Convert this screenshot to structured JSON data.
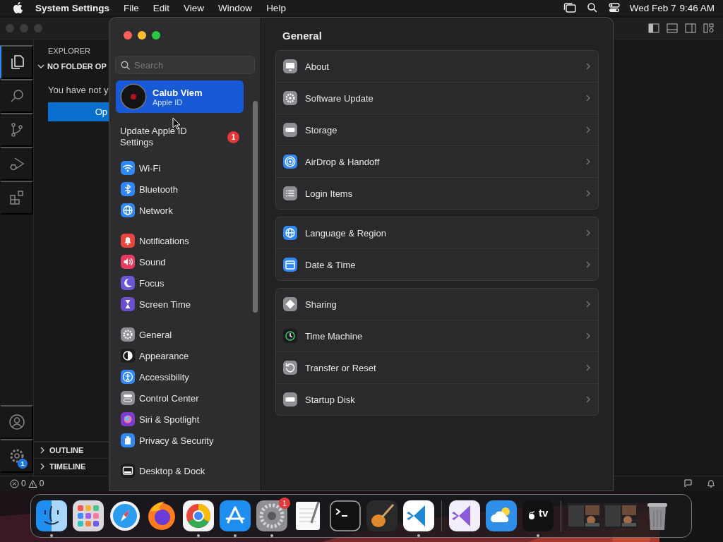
{
  "menu_bar": {
    "app_name": "System Settings",
    "menus": [
      "File",
      "Edit",
      "View",
      "Window",
      "Help"
    ],
    "date": "Wed Feb 7",
    "time": "9:46 AM"
  },
  "editor": {
    "activity": [
      {
        "kind": "files",
        "selected": true
      },
      {
        "kind": "search",
        "selected": false
      },
      {
        "kind": "branch",
        "selected": false
      },
      {
        "kind": "debug",
        "selected": false
      },
      {
        "kind": "blocks",
        "selected": false
      }
    ],
    "settings_badge": "1",
    "explorer": {
      "title": "EXPLORER",
      "section": "NO FOLDER OP",
      "message": "You have not y",
      "button": "Op",
      "panels": [
        "OUTLINE",
        "TIMELINE"
      ]
    },
    "status": {
      "errors": "0",
      "warnings": "0"
    }
  },
  "settings": {
    "search_placeholder": "Search",
    "account": {
      "name": "Calub Viem",
      "subtitle": "Apple ID",
      "selected": true
    },
    "update": {
      "label": "Update Apple ID Settings",
      "badge": "1"
    },
    "sidebar_groups": [
      [
        {
          "label": "Wi-Fi",
          "kind": "wifi",
          "color": "#2f88f5"
        },
        {
          "label": "Bluetooth",
          "kind": "bluetooth",
          "color": "#2f88f5"
        },
        {
          "label": "Network",
          "kind": "globe",
          "color": "#2f88f5"
        }
      ],
      [
        {
          "label": "Notifications",
          "kind": "bell",
          "color": "#e8453c"
        },
        {
          "label": "Sound",
          "kind": "speaker",
          "color": "#e83a5f"
        },
        {
          "label": "Focus",
          "kind": "moon",
          "color": "#6b56d6"
        },
        {
          "label": "Screen Time",
          "kind": "hourglass",
          "color": "#6b4fd0"
        }
      ],
      [
        {
          "label": "General",
          "kind": "gear",
          "color": "#8e8e93"
        },
        {
          "label": "Appearance",
          "kind": "contrast",
          "color": "#1c1c1e"
        },
        {
          "label": "Accessibility",
          "kind": "accessibility",
          "color": "#2f88f5"
        },
        {
          "label": "Control Center",
          "kind": "toggle",
          "color": "#8e8e93"
        },
        {
          "label": "Siri & Spotlight",
          "kind": "orb",
          "color": "#7a3ccf"
        },
        {
          "label": "Privacy & Security",
          "kind": "hand",
          "color": "#2f88f5"
        }
      ],
      [
        {
          "label": "Desktop & Dock",
          "kind": "dock",
          "color": "#1c1c1e"
        }
      ]
    ],
    "title": "General",
    "groups": [
      [
        {
          "label": "About",
          "kind": "monitor",
          "color": "#8e8e93"
        },
        {
          "label": "Software Update",
          "kind": "gear",
          "color": "#8e8e93"
        },
        {
          "label": "Storage",
          "kind": "drive",
          "color": "#8e8e93"
        },
        {
          "label": "AirDrop & Handoff",
          "kind": "rings",
          "color": "#2f88f5"
        },
        {
          "label": "Login Items",
          "kind": "list",
          "color": "#8e8e93"
        }
      ],
      [
        {
          "label": "Language & Region",
          "kind": "globe",
          "color": "#2f88f5"
        },
        {
          "label": "Date & Time",
          "kind": "calendar",
          "color": "#2f88f5"
        }
      ],
      [
        {
          "label": "Sharing",
          "kind": "diamond",
          "color": "#8e8e93"
        },
        {
          "label": "Time Machine",
          "kind": "clock",
          "color": "#1c1c1e"
        },
        {
          "label": "Transfer or Reset",
          "kind": "reset",
          "color": "#8e8e93"
        },
        {
          "label": "Startup Disk",
          "kind": "drive",
          "color": "#8e8e93"
        }
      ]
    ]
  },
  "dock": {
    "groups": [
      [
        {
          "kind": "face",
          "running": true
        },
        {
          "kind": "grid",
          "running": false
        },
        {
          "kind": "compass",
          "running": false
        },
        {
          "kind": "fox",
          "running": false
        },
        {
          "kind": "wheel",
          "running": true
        },
        {
          "kind": "tools",
          "running": true
        },
        {
          "kind": "gear",
          "running": true,
          "badge": "1"
        },
        {
          "kind": "notepad",
          "running": false
        },
        {
          "kind": "terminal",
          "running": false
        },
        {
          "kind": "guitar",
          "running": false
        },
        {
          "kind": "ribbon",
          "running": true
        }
      ],
      [
        {
          "kind": "loop",
          "running": false
        },
        {
          "kind": "cloud",
          "running": false
        },
        {
          "kind": "tv",
          "running": true,
          "label": "tv"
        }
      ],
      [
        {
          "kind": "picture",
          "running": false
        },
        {
          "kind": "picture",
          "running": false
        },
        {
          "kind": "trash",
          "running": false
        }
      ]
    ]
  }
}
